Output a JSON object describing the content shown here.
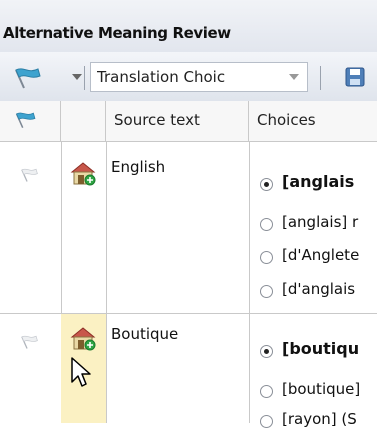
{
  "panel": {
    "title": "Alternative Meaning Review"
  },
  "toolbar": {
    "combo_value": "Translation Choic"
  },
  "table": {
    "columns": [
      "",
      "",
      "Source text",
      "Choices"
    ],
    "rows": [
      {
        "source": "English",
        "choices": [
          {
            "text": "[anglais",
            "selected": true
          },
          {
            "text": "[anglais] r",
            "selected": false
          },
          {
            "text": "[d'Anglete",
            "selected": false
          },
          {
            "text": "[d'anglais",
            "selected": false
          }
        ]
      },
      {
        "source": "Boutique",
        "choices": [
          {
            "text": "[boutiqu",
            "selected": true
          },
          {
            "text": "[boutique]",
            "selected": false
          },
          {
            "text": "[rayon] (S",
            "selected": false
          }
        ]
      }
    ]
  }
}
